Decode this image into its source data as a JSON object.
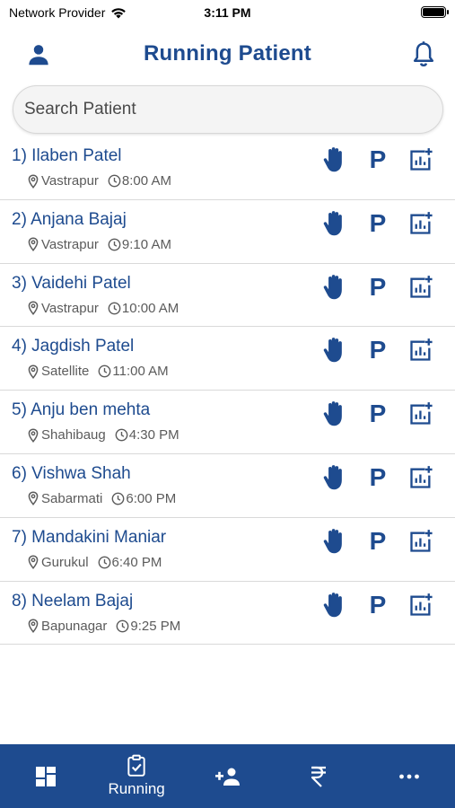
{
  "status_bar": {
    "carrier": "Network Provider",
    "time": "3:11 PM"
  },
  "header": {
    "title": "Running Patient"
  },
  "search": {
    "placeholder": "Search Patient"
  },
  "parking_symbol": "P",
  "patients": [
    {
      "name": "1) Ilaben Patel",
      "location": "Vastrapur",
      "time": "8:00 AM"
    },
    {
      "name": "2) Anjana Bajaj",
      "location": "Vastrapur",
      "time": "9:10 AM"
    },
    {
      "name": "3) Vaidehi Patel",
      "location": "Vastrapur",
      "time": "10:00 AM"
    },
    {
      "name": "4) Jagdish Patel",
      "location": "Satellite",
      "time": "11:00 AM"
    },
    {
      "name": "5) Anju ben mehta",
      "location": "Shahibaug",
      "time": "4:30 PM"
    },
    {
      "name": "6) Vishwa Shah",
      "location": "Sabarmati",
      "time": "6:00 PM"
    },
    {
      "name": "7) Mandakini Maniar",
      "location": "Gurukul",
      "time": "6:40 PM"
    },
    {
      "name": "8) Neelam Bajaj",
      "location": "Bapunagar",
      "time": "9:25 PM"
    }
  ],
  "bottom_nav": {
    "items": [
      {
        "icon": "dashboard-icon",
        "label": ""
      },
      {
        "icon": "clipboard-check-icon",
        "label": "Running"
      },
      {
        "icon": "add-person-icon",
        "label": ""
      },
      {
        "icon": "rupee-icon",
        "label": ""
      },
      {
        "icon": "more-icon",
        "label": ""
      }
    ]
  },
  "colors": {
    "primary": "#1e4b8f",
    "meta_text": "#5b5b5b",
    "divider": "#d9d9d9"
  }
}
